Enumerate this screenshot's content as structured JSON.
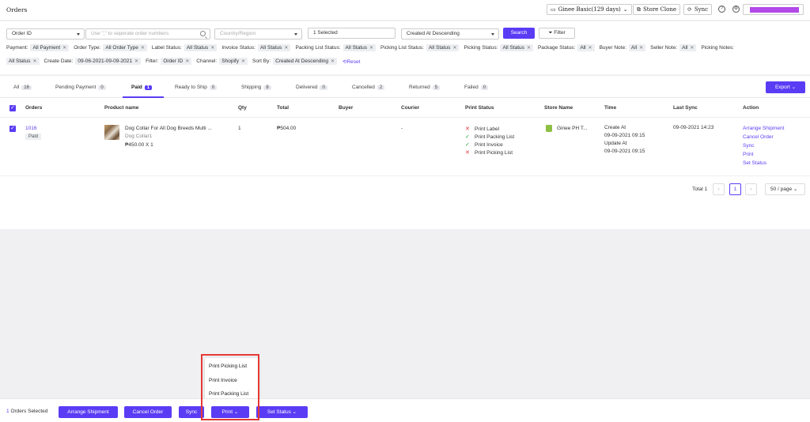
{
  "header": {
    "title": "Orders",
    "plan": "Ginee Basic(129 days)",
    "store_clone": "Store Clone",
    "sync": "Sync",
    "help": "?"
  },
  "filters": {
    "search_field": "Order ID",
    "search_placeholder": "Use \",\" to seperate order numbers",
    "country_placeholder": "Country/Region",
    "selected": "1 Selected",
    "sort_select": "Created At Descending",
    "search_button": "Search",
    "filter_button": "Filter",
    "chips_row1": [
      {
        "label": "Payment:",
        "value": "All Payment"
      },
      {
        "label": "Order Type:",
        "value": "All Order Type"
      },
      {
        "label": "Label Status:",
        "value": "All Status"
      },
      {
        "label": "Invoice Status:",
        "value": "All Status"
      },
      {
        "label": "Packing List Status:",
        "value": "All Status"
      },
      {
        "label": "Picking List Status:",
        "value": "All Status"
      },
      {
        "label": "Picking Status:",
        "value": "All Status"
      },
      {
        "label": "Package Status:",
        "value": "All"
      },
      {
        "label": "Buyer Note:",
        "value": "All"
      },
      {
        "label": "Seller Note:",
        "value": "All"
      },
      {
        "label": "Picking Notes:",
        "value": ""
      }
    ],
    "chips_row2": [
      {
        "label": "",
        "value": "All Status"
      },
      {
        "label": "Create Date:",
        "value": "09-06-2021-09-09-2021"
      },
      {
        "label": "Filter:",
        "value": "Order ID"
      },
      {
        "label": "Channel:",
        "value": "Shopify"
      },
      {
        "label": "Sort By:",
        "value": "Created At Descending"
      }
    ],
    "reset": "Reset"
  },
  "tabs": [
    {
      "label": "All",
      "count": "16"
    },
    {
      "label": "Pending Payment",
      "count": "0"
    },
    {
      "label": "Paid",
      "count": "1"
    },
    {
      "label": "Ready to Ship",
      "count": "0"
    },
    {
      "label": "Shipping",
      "count": "8"
    },
    {
      "label": "Delivered",
      "count": "0"
    },
    {
      "label": "Cancelled",
      "count": "2"
    },
    {
      "label": "Returned",
      "count": "5"
    },
    {
      "label": "Failed",
      "count": "0"
    }
  ],
  "export_label": "Export",
  "table": {
    "columns": [
      "Orders",
      "Product name",
      "Qty",
      "Total",
      "Buyer",
      "Courier",
      "Print Status",
      "Store Name",
      "Time",
      "Last Sync",
      "Action"
    ],
    "row": {
      "order_id": "1016",
      "status": "Paid",
      "product_name": "Dog Collar For All Dog Breeds Multi ...",
      "variant": "Dog Collar1",
      "price_line": "₱450.00 X 1",
      "qty": "1",
      "total": "₱504.00",
      "courier": "-",
      "print_status": [
        {
          "label": "Print Label",
          "done": false
        },
        {
          "label": "Print Packing List",
          "done": true
        },
        {
          "label": "Print Invoice",
          "done": true
        },
        {
          "label": "Print Picking List",
          "done": false
        }
      ],
      "store": "Ginee PH T...",
      "create_label": "Create At",
      "create_time": "09-09-2021 09:15",
      "update_label": "Update At",
      "update_time": "09-09-2021 09:15",
      "last_sync": "09-09-2021 14:23",
      "actions": [
        "Arrange Shipment",
        "Cancel Order",
        "Sync",
        "Print",
        "Set Status"
      ]
    }
  },
  "pagination": {
    "total": "Total 1",
    "current": "1",
    "per_page": "50 / page"
  },
  "bottom": {
    "selected_count": "1",
    "selected_suffix": "Orders Selected",
    "arrange": "Arrange Shipment",
    "cancel": "Cancel Order",
    "sync": "Sync",
    "print": "Print",
    "set_status": "Set Status"
  },
  "print_menu": [
    "Print Picking List",
    "Print Invoice",
    "Print Packing List"
  ]
}
